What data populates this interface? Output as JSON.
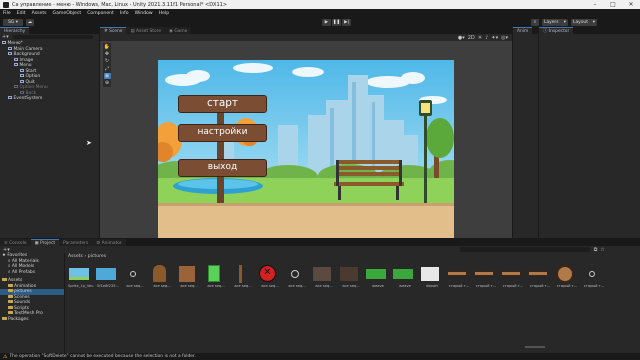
{
  "window_title": "Са управление - меню - Windows, Mac, Linux - Unity 2021.3.11f1 Personal* <DX11>",
  "menu": [
    "File",
    "Edit",
    "Assets",
    "GameObject",
    "Component",
    "Info",
    "Window",
    "Help"
  ],
  "toolbar": {
    "account": "SG",
    "layers": "Layers",
    "layout": "Layout"
  },
  "hierarchy": {
    "tab": "Hierarchy",
    "items": [
      {
        "label": "Меню*",
        "indent": 0
      },
      {
        "label": "Main Camera",
        "indent": 1
      },
      {
        "label": "Background",
        "indent": 1
      },
      {
        "label": "Image",
        "indent": 2
      },
      {
        "label": "Menu",
        "indent": 2
      },
      {
        "label": "Start",
        "indent": 3
      },
      {
        "label": "Option",
        "indent": 3
      },
      {
        "label": "Quit",
        "indent": 3
      },
      {
        "label": "Option Menu",
        "indent": 2
      },
      {
        "label": "Back",
        "indent": 3
      },
      {
        "label": "EventSystem",
        "indent": 1
      }
    ]
  },
  "center_tabs": {
    "scene": "Scene",
    "asset_store": "Asset Store",
    "game": "Game"
  },
  "animator_tab": "Anim",
  "inspector_tab": "Inspector",
  "scene_buttons": {
    "start": "старт",
    "settings": "настройки",
    "exit": "выход"
  },
  "bottom_tabs": {
    "console": "Console",
    "project": "Project",
    "parameters": "Parameters",
    "animator": "Animator"
  },
  "project": {
    "favorites_label": "Favorites",
    "favorites": [
      "All Materials",
      "All Models",
      "All Prefabs"
    ],
    "assets_label": "Assets",
    "assets": [
      "Animation",
      "pictures",
      "Scenes",
      "Sounds",
      "Scripts",
      "TextMesh Pro"
    ],
    "packages_label": "Packages",
    "breadcrumb": [
      "Assets",
      "pictures"
    ],
    "files_row1": [
      "Sprite_1p_Vec...",
      "5f1e8f235...",
      "ace seq...",
      "ace seq...",
      "ace seq...",
      "ace seq...",
      "ace seq...",
      "ace seq...",
      "ace seq...",
      "ace seq...",
      "ace seq...",
      "weave",
      "weave",
      "depart",
      "старый т...",
      "старый т...",
      "старый т...",
      "старый т..."
    ],
    "files_row2": [
      "старый т...",
      "старый т..."
    ]
  },
  "status_text": "The operation \"SoftDelete\" cannot be executed because the selection is not a folder."
}
